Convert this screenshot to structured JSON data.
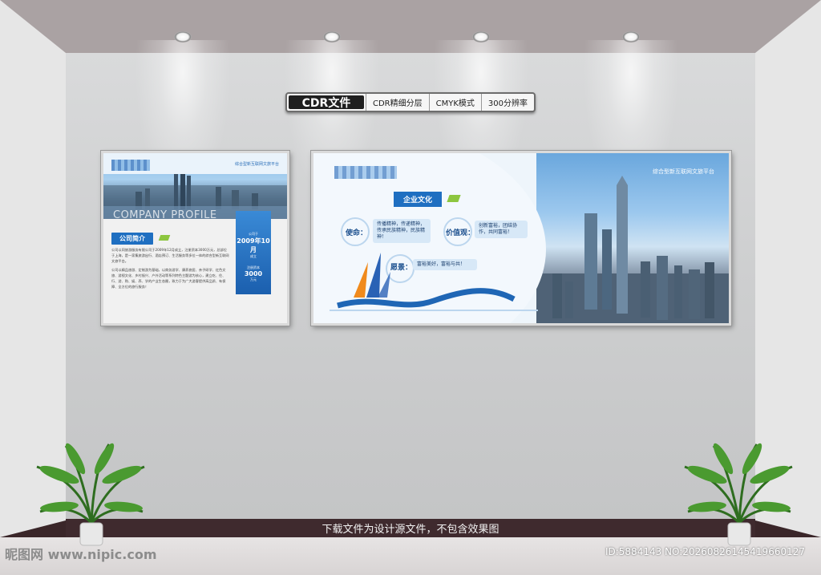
{
  "badge": {
    "format": "CDR文件",
    "items": [
      "CDR精细分层",
      "CMYK模式",
      "300分辨率"
    ]
  },
  "left_board": {
    "tagline": "综合型新互联网文旅平台",
    "profile": "COMPANY PROFILE",
    "section_title": "公司简介",
    "paragraph1": "公司以同旅游服务有限公司于2009年12月成立，注册资本3000万元，总部位于上海，是一家集旅游出行、酒店预订、生活服务等多位一体的综合型新互联网文旅平台。",
    "paragraph2": "公司以精品旅游、定制游为基础，以商务游学、康养旅居、亲子研学、红色文旅、游视文化、乡村振兴、户外活动等系列特色主题游为核心，建立吃、住、行、游、购、娱、养、学的产业生态圈，致力于为广大游客提供高品质、有保障、全方位的旅行服务！",
    "stat1_label": "公司于",
    "stat1_value": "2009年10月",
    "stat1_sub": "成立",
    "stat2_label": "注册资本",
    "stat2_value": "3000",
    "stat2_sub": "万元"
  },
  "right_board": {
    "tagline": "综合型新互联网文旅平台",
    "section_title": "企业文化",
    "mission_label": "使命：",
    "mission_text": "传播精神，传递精神，传承民族精神，民族精神！",
    "values_label": "价值观：",
    "values_text": "创新富裕，团结协作，共同富裕！",
    "vision_label": "愿景：",
    "vision_text": "富裕美好，富裕与共！"
  },
  "footer": {
    "notice": "下载文件为设计源文件，不包含效果图",
    "site": "昵图网 www.nipic.com",
    "id": "ID:5884143 NO:20260826145419660127"
  }
}
